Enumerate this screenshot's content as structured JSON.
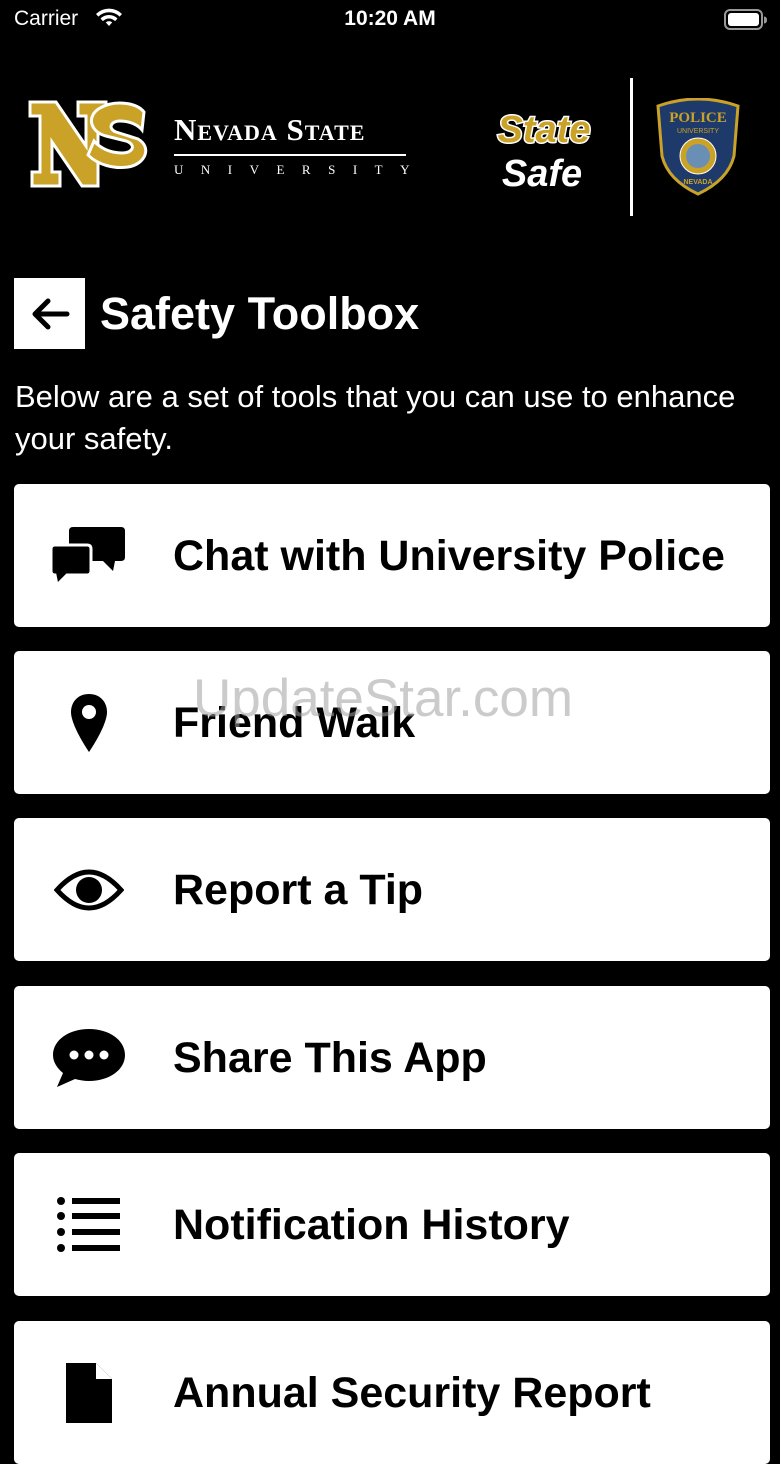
{
  "status_bar": {
    "carrier": "Carrier",
    "time": "10:20 AM"
  },
  "header": {
    "university_name": "Nevada State",
    "university_sub": "UNIVERSITY",
    "app_brand_top": "State",
    "app_brand_bottom": "Safe",
    "badge_top": "POLICE",
    "badge_mid": "UNIVERSITY",
    "badge_bottom": "NEVADA"
  },
  "page": {
    "title": "Safety Toolbox",
    "intro": "Below are a set of tools that you can use to enhance your safety."
  },
  "tools": [
    {
      "label": "Chat with University Police",
      "icon": "chat-bubbles-icon"
    },
    {
      "label": "Friend Walk",
      "icon": "map-pin-icon"
    },
    {
      "label": "Report a Tip",
      "icon": "eye-icon"
    },
    {
      "label": "Share This App",
      "icon": "speech-dots-icon"
    },
    {
      "label": "Notification History",
      "icon": "list-icon"
    },
    {
      "label": "Annual Security Report",
      "icon": "document-icon"
    }
  ],
  "watermark": "UpdateStar.com",
  "colors": {
    "background": "#000000",
    "card": "#ffffff",
    "gold": "#c9a227"
  }
}
